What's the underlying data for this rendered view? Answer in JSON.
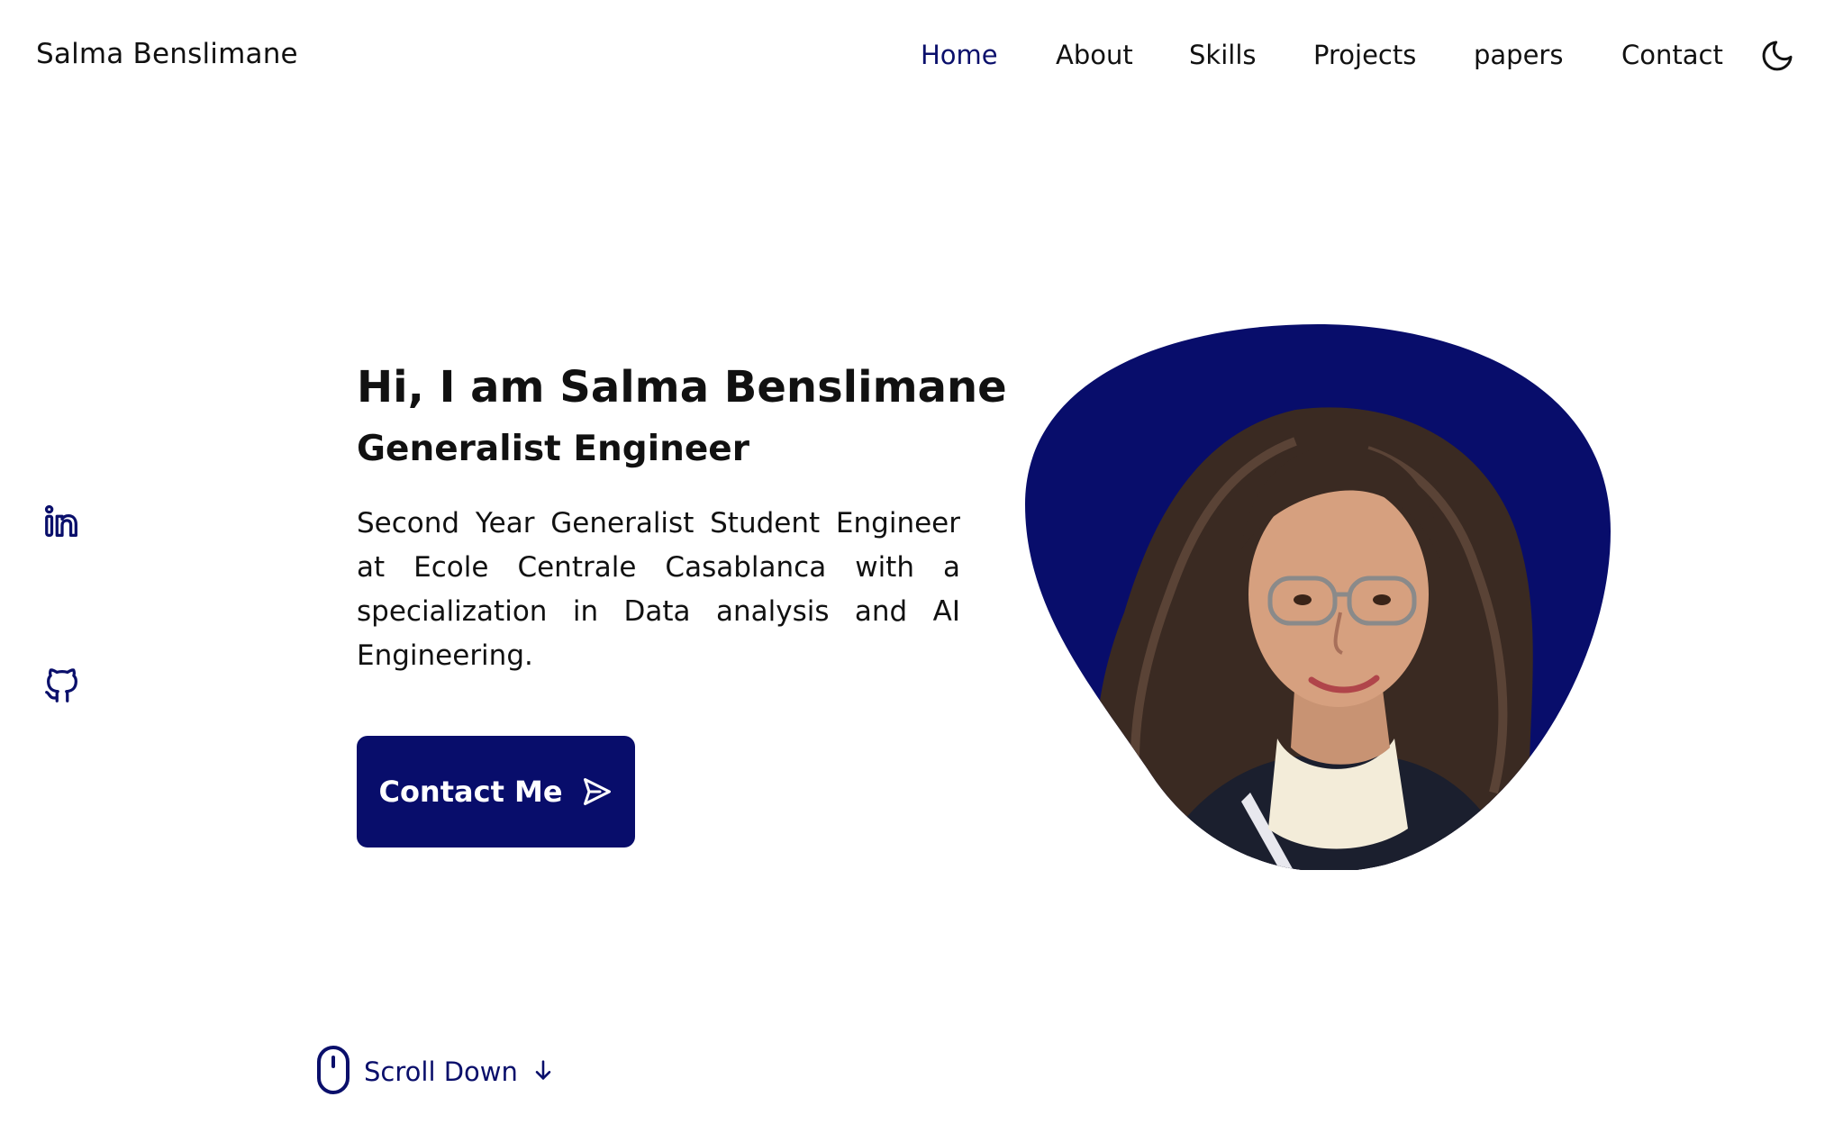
{
  "brand": {
    "name": "Salma Benslimane"
  },
  "nav": {
    "items": [
      {
        "label": "Home",
        "active": true
      },
      {
        "label": "About",
        "active": false
      },
      {
        "label": "Skills",
        "active": false
      },
      {
        "label": "Projects",
        "active": false
      },
      {
        "label": "papers",
        "active": false
      },
      {
        "label": "Contact",
        "active": false
      }
    ],
    "theme_toggle_icon": "moon-icon"
  },
  "social": {
    "items": [
      {
        "icon": "linkedin-icon"
      },
      {
        "icon": "github-icon"
      }
    ]
  },
  "hero": {
    "title": "Hi, I am Salma Benslimane",
    "subtitle": "Generalist Engineer",
    "description": "Second Year Generalist Student Engineer at Ecole Centrale Casablanca with a specialization in Data analysis and AI Engineering.",
    "cta_label": "Contact Me",
    "cta_icon": "send-icon",
    "photo_icon": "profile-photo"
  },
  "scroll": {
    "label": "Scroll Down",
    "mouse_icon": "mouse-icon",
    "arrow_icon": "arrow-down-icon"
  },
  "colors": {
    "accent": "#0a0f6b",
    "blob": "#080d6b",
    "text": "#111111",
    "background": "#ffffff"
  }
}
